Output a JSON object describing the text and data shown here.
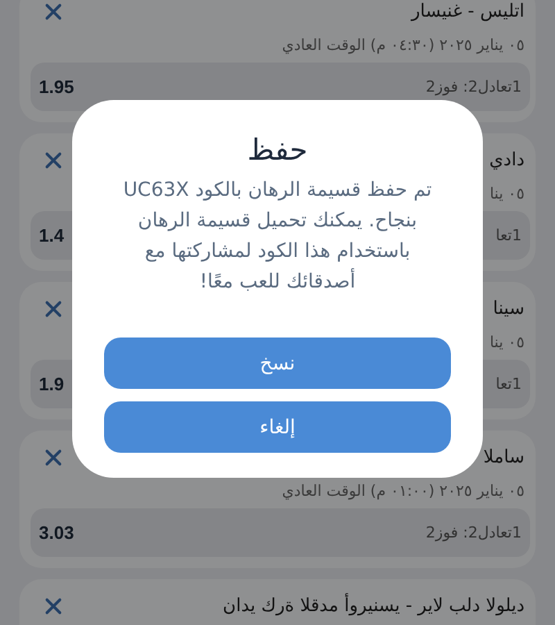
{
  "bets": [
    {
      "title": "اتليس - غنيسار",
      "date": "٠٥ يناير ٢٠٢٥ (٠٤:٣٠ م) الوقت العادي",
      "selection": "1تعادل2: فوز2",
      "odds": "1.95"
    },
    {
      "title": "دادي",
      "date": "٠٥ ينا",
      "selection": "1تعا",
      "odds": "1.4"
    },
    {
      "title": "سينا",
      "date": "٠٥ ينا",
      "selection": "1تعا",
      "odds": "1.9"
    },
    {
      "title": "ساملا",
      "date": "٠٥ يناير ٢٠٢٥ (٠١:٠٠ م) الوقت العادي",
      "selection": "1تعادل2: فوز2",
      "odds": "3.03"
    },
    {
      "title": "ديلولا دلب لاير - يسنيروأ مدقلا ةرك يدان"
    }
  ],
  "dialog": {
    "title": "حفظ",
    "message": "تم حفظ قسيمة الرهان بالكود UC63X بنجاح. يمكنك تحميل قسيمة الرهان باستخدام هذا الكود لمشاركتها مع أصدقائك للعب معًا!",
    "buttons": [
      "نسخ",
      "إلغاء"
    ]
  }
}
